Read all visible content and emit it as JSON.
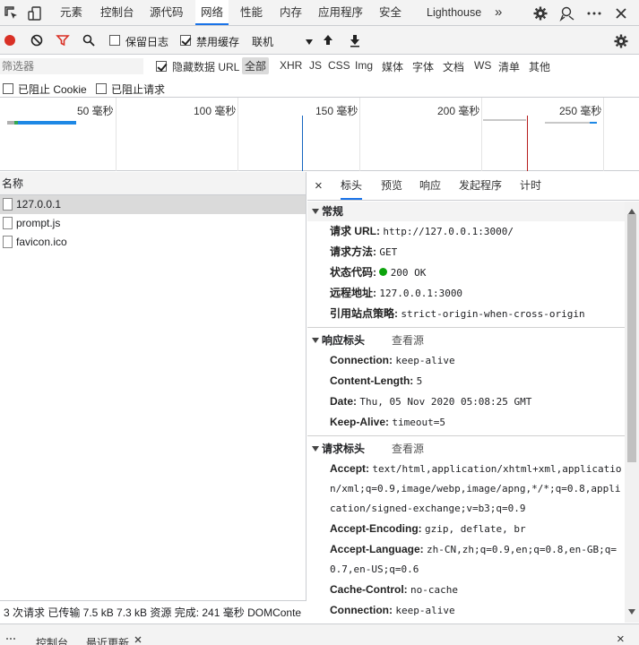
{
  "top_tabs": {
    "inspect_icon": "inspect-element-icon",
    "device_icon": "device-toolbar-icon",
    "items": [
      "元素",
      "控制台",
      "源代码",
      "网络",
      "性能",
      "内存",
      "应用程序",
      "安全",
      "Lighthouse"
    ],
    "more": "»",
    "active": "网络"
  },
  "toolbar": {
    "preserve_log": "保留日志",
    "disable_cache": "禁用缓存",
    "throttle": "联机"
  },
  "filter": {
    "placeholder": "筛选器",
    "hide_data_url": "隐藏数据 URL",
    "types": [
      "全部",
      "XHR",
      "JS",
      "CSS",
      "Img",
      "媒体",
      "字体",
      "文档",
      "WS",
      "清单",
      "其他"
    ],
    "blocked_cookies": "已阻止 Cookie",
    "blocked_requests": "已阻止请求"
  },
  "overview": {
    "labels": [
      "50 毫秒",
      "100 毫秒",
      "150 毫秒",
      "200 毫秒",
      "250 毫秒"
    ]
  },
  "requests": {
    "header": "名称",
    "items": [
      "127.0.0.1",
      "prompt.js",
      "favicon.ico"
    ]
  },
  "status": {
    "text": "3 次请求  已传输 7.5 kB  7.3 kB 资源  完成: 241 毫秒  DOMConte"
  },
  "details": {
    "close": "×",
    "tabs": [
      "标头",
      "预览",
      "响应",
      "发起程序",
      "计时"
    ],
    "general": {
      "title": "常规",
      "rows": [
        {
          "k": "请求 URL:",
          "v": "http://127.0.0.1:3000/"
        },
        {
          "k": "请求方法:",
          "v": "GET"
        },
        {
          "k": "状态代码:",
          "v": "200 OK"
        },
        {
          "k": "远程地址:",
          "v": "127.0.0.1:3000"
        },
        {
          "k": "引用站点策略:",
          "v": "strict-origin-when-cross-origin"
        }
      ]
    },
    "response": {
      "title": "响应标头",
      "source": "查看源",
      "rows": [
        {
          "k": "Connection:",
          "v": "keep-alive"
        },
        {
          "k": "Content-Length:",
          "v": "5"
        },
        {
          "k": "Date:",
          "v": "Thu, 05 Nov 2020 05:08:25 GMT"
        },
        {
          "k": "Keep-Alive:",
          "v": "timeout=5"
        }
      ]
    },
    "request": {
      "title": "请求标头",
      "source": "查看源",
      "accept_k": "Accept:",
      "accept_v1": "text/html,application/xhtml+xml,applicatio",
      "accept_v2": "n/xml;q=0.9,image/webp,image/apng,*/*;q=0.8,appli",
      "accept_v3": "cation/signed-exchange;v=b3;q=0.9",
      "enc_k": "Accept-Encoding:",
      "enc_v": "gzip, deflate, br",
      "lang_k": "Accept-Language:",
      "lang_v1": "zh-CN,zh;q=0.9,en;q=0.8,en-GB;q=",
      "lang_v2": "0.7,en-US;q=0.6",
      "cache_k": "Cache-Control:",
      "cache_v": "no-cache",
      "conn_k": "Connection:",
      "conn_v": "keep-alive"
    }
  },
  "drawer": {
    "tabs": [
      "控制台",
      "最近更新"
    ],
    "close": "×"
  },
  "colors": {
    "accent": "#1a73e8",
    "record": "#d93025",
    "filter_icon": "#d93025",
    "status_ok": "#0ca30c"
  }
}
